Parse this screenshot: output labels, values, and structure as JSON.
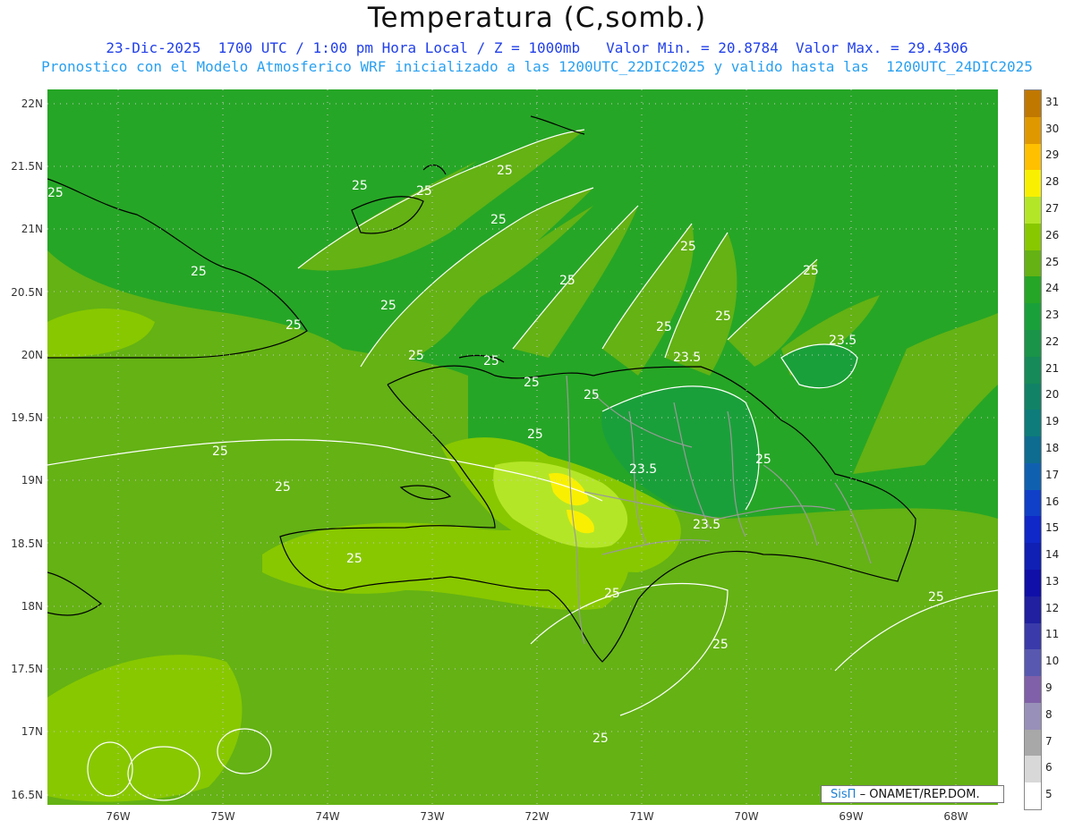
{
  "header": {
    "title": "Temperatura (C,somb.)",
    "line1": "23-Dic-2025  1700 UTC / 1:00 pm Hora Local / Z = 1000mb   Valor Min. = 20.8784  Valor Max. = 29.4306",
    "line2": "Pronostico con el Modelo Atmosferico WRF inicializado a las 1200UTC_22DIC2025 y valido hasta las  1200UTC_24DIC2025"
  },
  "axes": {
    "lat_labels": [
      "22N",
      "21.5N",
      "21N",
      "20.5N",
      "20N",
      "19.5N",
      "19N",
      "18.5N",
      "18N",
      "17.5N",
      "17N",
      "16.5N"
    ],
    "lon_labels": [
      "76W",
      "75W",
      "74W",
      "73W",
      "72W",
      "71W",
      "70W",
      "69W",
      "68W"
    ]
  },
  "contour_labels": [
    "25",
    "25",
    "25",
    "25",
    "25",
    "25",
    "25",
    "25",
    "25",
    "25",
    "25",
    "25",
    "25",
    "25",
    "25",
    "25",
    "25",
    "25",
    "25",
    "25",
    "25",
    "25",
    "25",
    "25",
    "23.5",
    "23.5",
    "23.5",
    "23.5",
    "25",
    "25"
  ],
  "colorbar": {
    "labels": [
      "31",
      "30",
      "29",
      "28",
      "27",
      "26",
      "25",
      "24",
      "23",
      "22",
      "21",
      "20",
      "19",
      "18",
      "17",
      "16",
      "15",
      "14",
      "13",
      "12",
      "11",
      "10",
      "9",
      "8",
      "7",
      "6",
      "5"
    ],
    "colors": [
      "#c07800",
      "#e09800",
      "#ffc000",
      "#f8f000",
      "#b4e628",
      "#88c800",
      "#64b214",
      "#26a626",
      "#1aa03a",
      "#1a9448",
      "#168a58",
      "#128266",
      "#0e7c7a",
      "#0e6c90",
      "#1060b0",
      "#1040c8",
      "#1028c8",
      "#1020b4",
      "#1010a8",
      "#2020a0",
      "#3a3aaa",
      "#5858b0",
      "#8060a8",
      "#9890b8",
      "#a8a8a8",
      "#d8d8d8",
      "#ffffff"
    ]
  },
  "logo": {
    "brand": "SisΠ",
    "org": "– ONAMET/REP.DOM."
  }
}
